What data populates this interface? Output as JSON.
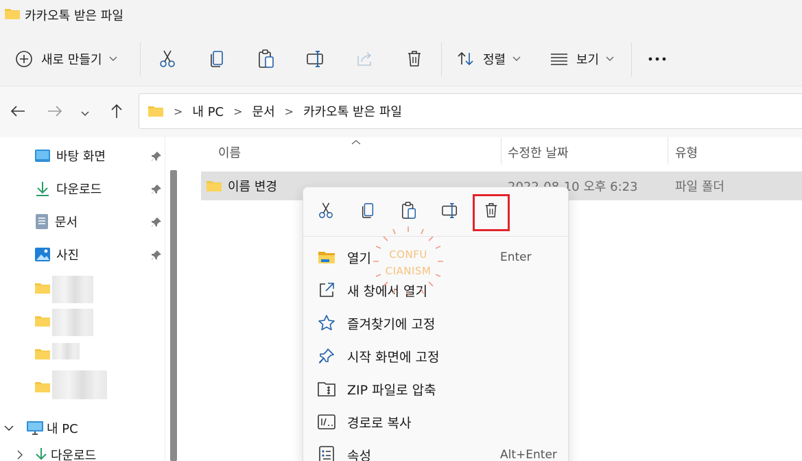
{
  "window": {
    "title": "카카오톡 받은 파일"
  },
  "toolbar": {
    "new_label": "새로 만들기",
    "sort_label": "정렬",
    "view_label": "보기"
  },
  "address": {
    "crumbs": [
      "내 PC",
      "문서",
      "카카오톡 받은 파일"
    ]
  },
  "sidebar": {
    "items": [
      {
        "label": "바탕 화면"
      },
      {
        "label": "다운로드"
      },
      {
        "label": "문서"
      },
      {
        "label": "사진"
      }
    ],
    "this_pc": "내 PC",
    "bottom_item": "다운로드"
  },
  "columns": {
    "name": "이름",
    "date": "수정한 날짜",
    "type": "유형"
  },
  "rows": [
    {
      "name": "이름 변경",
      "date": "2022-08-10 오후 6:23",
      "type": "파일 폴더"
    }
  ],
  "context_menu": {
    "items": [
      {
        "label": "열기",
        "shortcut": "Enter"
      },
      {
        "label": "새 창에서 열기",
        "shortcut": ""
      },
      {
        "label": "즐겨찾기에 고정",
        "shortcut": ""
      },
      {
        "label": "시작 화면에 고정",
        "shortcut": ""
      },
      {
        "label": "ZIP 파일로 압축",
        "shortcut": ""
      },
      {
        "label": "경로로 복사",
        "shortcut": ""
      },
      {
        "label": "속성",
        "shortcut": "Alt+Enter"
      }
    ],
    "highlight_color": "#e2242a"
  },
  "watermark": {
    "line1": "CONFU",
    "line2": "CIANISM"
  },
  "colors": {
    "accent": "#005fb8",
    "folder": "#f2c744",
    "selection": "#e0e0e0"
  }
}
